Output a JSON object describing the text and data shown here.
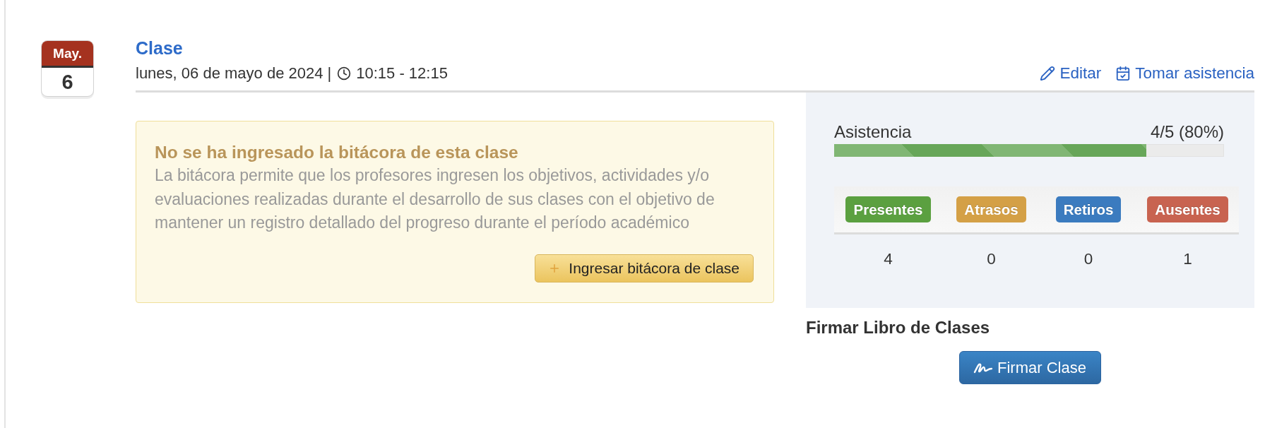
{
  "calendar": {
    "month": "May.",
    "day": "6"
  },
  "header": {
    "title": "Clase",
    "date": "lunes, 06 de mayo de 2024 |",
    "time": "10:15 - 12:15",
    "actions": [
      {
        "kind": "edit",
        "label": "Editar"
      },
      {
        "kind": "attendance",
        "label": "Tomar asistencia"
      }
    ]
  },
  "log_notice": {
    "title": "No se ha ingresado la bitácora de esta clase",
    "text": "La bitácora permite que los profesores ingresen los objetivos, actividades y/o evaluaciones realizadas durante el desarrollo de sus clases con el objetivo de mantener un registro detallado del progreso durante el período académico",
    "button": "Ingresar bitácora de clase"
  },
  "attendance": {
    "label": "Asistencia",
    "reading": "4/5 (80%)",
    "level": 0.8,
    "categories": [
      {
        "label": "Presentes",
        "color": "#5ba040",
        "count": "4"
      },
      {
        "label": "Atrasos",
        "color": "#d4a046",
        "count": "0"
      },
      {
        "label": "Retiros",
        "color": "#3b7bbf",
        "count": "0"
      },
      {
        "label": "Ausentes",
        "color": "#c86350",
        "count": "1"
      }
    ]
  },
  "signature": {
    "heading": "Firmar Libro de Clases",
    "button": "Firmar Clase"
  }
}
